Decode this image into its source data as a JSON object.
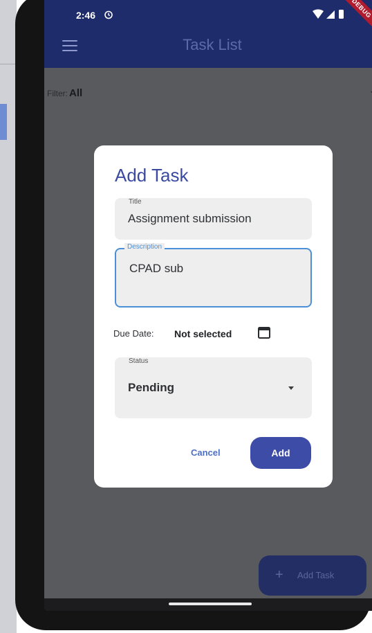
{
  "status_bar": {
    "time": "2:46",
    "debug_banner": "DEBUG"
  },
  "app_bar": {
    "title": "Task List",
    "menu_icon": "menu-icon"
  },
  "filter": {
    "label": "Filter:",
    "value": "All"
  },
  "dialog": {
    "title": "Add Task",
    "title_field": {
      "label": "Title",
      "value": "Assignment submission"
    },
    "description_field": {
      "label": "Description",
      "value": "CPAD sub"
    },
    "due_date": {
      "label": "Due Date:",
      "value": "Not selected",
      "icon": "calendar-icon"
    },
    "status_field": {
      "label": "Status",
      "value": "Pending"
    },
    "cancel_label": "Cancel",
    "add_label": "Add"
  },
  "fab": {
    "label": "Add Task",
    "icon": "plus-icon"
  },
  "colors": {
    "app_bar": "#1f2c6b",
    "primary_button": "#3d4ca6",
    "focus_border": "#4a8fd8",
    "dialog_title": "#3b4aa0"
  }
}
